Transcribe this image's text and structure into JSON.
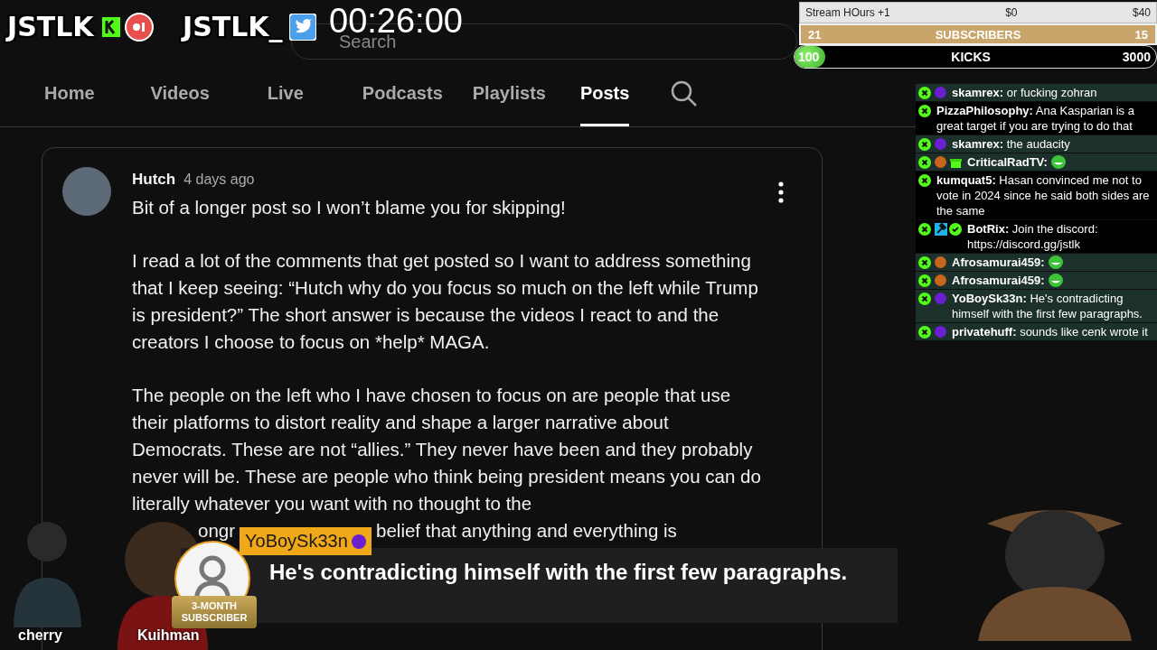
{
  "overlay": {
    "logos": [
      {
        "text": "JSTLK",
        "kind": "kick"
      },
      {
        "text": "JSTLK_",
        "kind": "twitter"
      }
    ],
    "timer": "00:26:00",
    "goals": {
      "stream_hours": {
        "label": "Stream HOurs +1",
        "current": "$0",
        "target": "$40"
      },
      "subscribers": {
        "current": "21",
        "label": "SUBSCRIBERS",
        "target": "15"
      },
      "kicks": {
        "current": "100",
        "label": "KICKS",
        "target": "3000",
        "level": 0.03
      }
    },
    "chat": [
      {
        "user": "skamrex:",
        "text": "or fucking zohran",
        "color": "#6a1fd0",
        "highlighted": true,
        "kind": "text"
      },
      {
        "user": "PizzaPhilosophy:",
        "text": "Ana Kasparian is a great target if you are trying to do that",
        "highlighted": false,
        "kind": "text"
      },
      {
        "user": "skamrex:",
        "text": "the audacity",
        "color": "#6a1fd0",
        "highlighted": true,
        "kind": "text"
      },
      {
        "user": "CriticalRadTV:",
        "color": "#c8661e",
        "gift": true,
        "highlighted": true,
        "kind": "emote"
      },
      {
        "user": "kumquat5:",
        "text": "Hasan convinced me not to vote in 2024 since he said both sides are the same",
        "highlighted": false,
        "kind": "text"
      },
      {
        "user": "BotRix:",
        "text": "Join the discord: https://discord.gg/jstlk",
        "moderator": true,
        "verified": true,
        "highlighted": false,
        "kind": "text"
      },
      {
        "user": "Afrosamurai459:",
        "color": "#c8661e",
        "highlighted": true,
        "kind": "emote"
      },
      {
        "user": "Afrosamurai459:",
        "color": "#c8661e",
        "highlighted": true,
        "kind": "emote"
      },
      {
        "user": "YoBoySk33n:",
        "text": "He's contradicting himself with the first few paragraphs.",
        "color": "#6a1fd0",
        "highlighted": true,
        "kind": "text"
      },
      {
        "user": "privatehuff:",
        "text": "sounds like cenk wrote it",
        "color": "#6a1fd0",
        "highlighted": true,
        "kind": "text"
      }
    ],
    "streamers": [
      {
        "name": "cherry"
      },
      {
        "name": "Kuihman"
      }
    ],
    "alert": {
      "username": "YoBoySk33n",
      "color": "#6a1fd0",
      "badge": "3-MONTH SUBSCRIBER",
      "message": "He's contradicting himself with the first few paragraphs."
    }
  },
  "page": {
    "search": {
      "placeholder": "Search"
    },
    "tabs": [
      {
        "label": "Home",
        "selected": false
      },
      {
        "label": "Videos",
        "selected": false
      },
      {
        "label": "Live",
        "selected": false
      },
      {
        "label": "Podcasts",
        "selected": false
      },
      {
        "label": "Playlists",
        "selected": false
      },
      {
        "label": "Posts",
        "selected": true
      }
    ],
    "post": {
      "author": "Hutch",
      "time": "4 days ago",
      "paragraphs": [
        "Bit of a longer post so I won’t blame you for skipping!",
        "I read a lot of the comments that get posted so I want to address something that I keep seeing: “Hutch why do you focus so much on the left while Trump is president?” The short answer is because the videos I react to and the creators I choose to focus on *help* MAGA.",
        "The people on the left who I have chosen to focus on are people that use their platforms to distort reality and shape a larger narrative about Democrats. These are not “allies.” They never have been and they probably never will be. These are people who think being president means you can do literally whatever you want with no thought to the"
      ],
      "partial_line": [
        "ongr",
        "belief that anything and everything is"
      ]
    }
  }
}
